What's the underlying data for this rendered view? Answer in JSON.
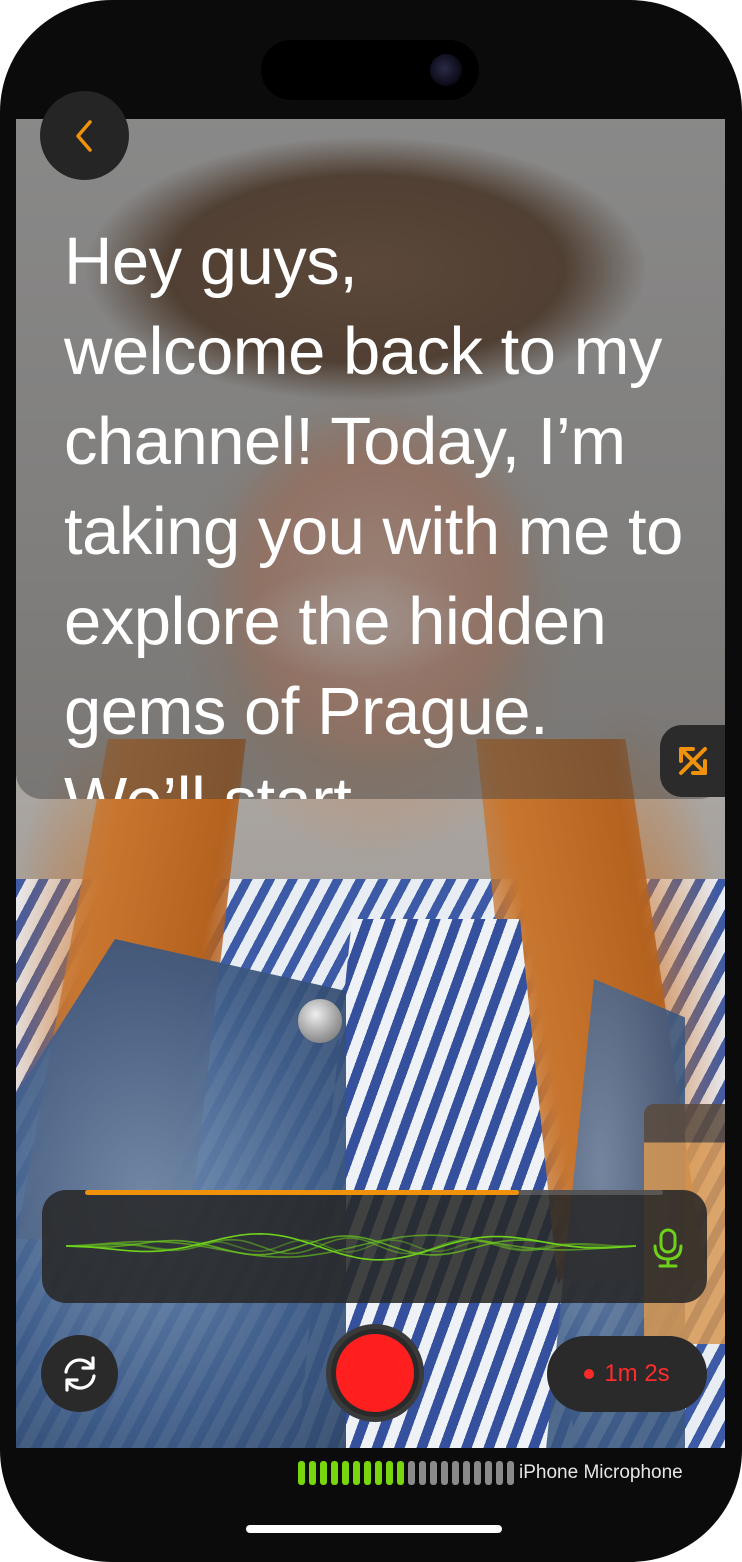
{
  "teleprompter": {
    "script_text": "Hey guys,\nwelcome back to my channel! Today, I’m taking you with me to explore the hidden gems of Prague. We’ll start"
  },
  "controls": {
    "back_icon": "chevron-left-icon",
    "resize_icon": "diagonal-arrows-icon",
    "flip_camera_icon": "camera-flip-icon",
    "record_icon": "record-icon"
  },
  "audio": {
    "progress": 0.75,
    "mic_icon": "microphone-icon",
    "level_segments_on": 10,
    "level_segments_total": 20,
    "source_label": "iPhone Microphone"
  },
  "timer": {
    "elapsed": "1m 2s"
  },
  "colors": {
    "accent": "#f0920c",
    "record": "#ff1f1f",
    "level_on": "#78d60c",
    "level_off": "#8a8a8a",
    "waveform": "#6fd11c"
  }
}
